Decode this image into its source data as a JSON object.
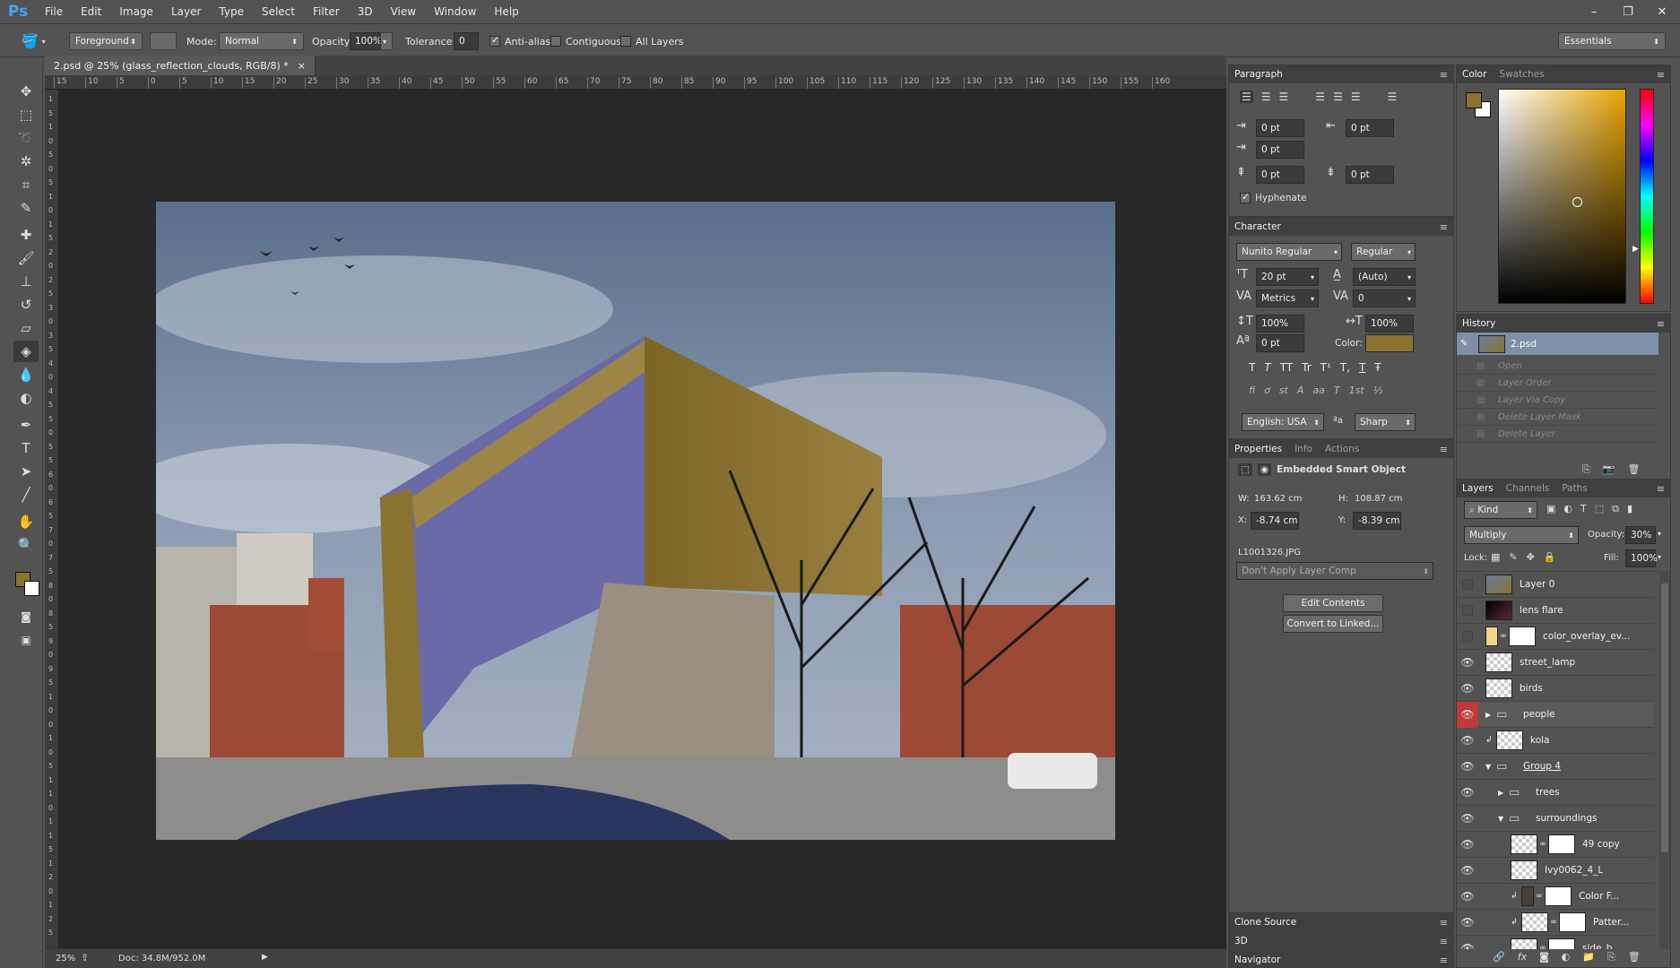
{
  "app": {
    "logo": "Ps",
    "menu": [
      "File",
      "Edit",
      "Image",
      "Layer",
      "Type",
      "Select",
      "Filter",
      "3D",
      "View",
      "Window",
      "Help"
    ],
    "window_controls": [
      "–",
      "❐",
      "✕"
    ]
  },
  "options_bar": {
    "fill_source": "Foreground",
    "mode_label": "Mode:",
    "mode_value": "Normal",
    "opacity_label": "Opacity:",
    "opacity_value": "100%",
    "tolerance_label": "Tolerance:",
    "tolerance_value": "0",
    "anti_alias_label": "Anti-alias",
    "anti_alias_checked": true,
    "contiguous_label": "Contiguous",
    "contiguous_checked": false,
    "all_layers_label": "All Layers",
    "all_layers_checked": false,
    "workspace": "Essentials"
  },
  "document": {
    "tab_title": "2.psd @ 25% (glass_reflection_clouds, RGB/8) *",
    "tab_close": "×",
    "ruler_top_ticks": [
      "15",
      "10",
      "5",
      "0",
      "5",
      "10",
      "15",
      "20",
      "25",
      "30",
      "35",
      "40",
      "45",
      "50",
      "55",
      "60",
      "65",
      "70",
      "75",
      "80",
      "85",
      "90",
      "95",
      "100",
      "105",
      "110",
      "115",
      "120",
      "125",
      "130",
      "135",
      "140",
      "145",
      "150",
      "155",
      "160"
    ],
    "ruler_left_ticks": [
      "1",
      "5",
      "1",
      "0",
      "5",
      "0",
      "5",
      "1",
      "0",
      "1",
      "5",
      "2",
      "0",
      "2",
      "5",
      "3",
      "0",
      "3",
      "5",
      "4",
      "0",
      "4",
      "5",
      "5",
      "0",
      "5",
      "5",
      "6",
      "0",
      "6",
      "5",
      "7",
      "0",
      "7",
      "5",
      "8",
      "0",
      "8",
      "5",
      "9",
      "0",
      "9",
      "5",
      "1",
      "0",
      "0",
      "1",
      "0",
      "5",
      "1",
      "1",
      "0",
      "1",
      "1",
      "5",
      "1",
      "2",
      "0",
      "1",
      "2",
      "5"
    ],
    "status_zoom": "25%",
    "status_doc": "Doc: 34.8M/952.0M"
  },
  "paragraph_panel": {
    "title": "Paragraph",
    "indent_left": "0 pt",
    "indent_right": "0 pt",
    "indent_first": "0 pt",
    "space_before": "0 pt",
    "space_after": "0 pt",
    "hyphenate_label": "Hyphenate",
    "hyphenate_checked": true
  },
  "character_panel": {
    "title": "Character",
    "font_family": "Nunito Regular",
    "font_style": "Regular",
    "font_size": "20 pt",
    "leading": "(Auto)",
    "kerning": "Metrics",
    "tracking": "0",
    "vertical_scale": "100%",
    "horizontal_scale": "100%",
    "baseline_shift": "0 pt",
    "color_label": "Color:",
    "color_value": "#8a7230",
    "style_buttons": [
      "T",
      "T",
      "TT",
      "Tr",
      "T¹",
      "T,",
      "T",
      "Ŧ"
    ],
    "opentype_buttons": [
      "fi",
      "ơ",
      "st",
      "A",
      "aa",
      "T",
      "1st",
      "½"
    ],
    "language": "English: USA",
    "aa_icon": "ªa",
    "antialias": "Sharp"
  },
  "properties_panel": {
    "tabs": [
      "Properties",
      "Info",
      "Actions"
    ],
    "kind": "Embedded Smart Object",
    "w_label": "W:",
    "w_value": "163.62 cm",
    "h_label": "H:",
    "h_value": "108.87 cm",
    "x_label": "X:",
    "x_value": "-8.74 cm",
    "y_label": "Y:",
    "y_value": "-8.39 cm",
    "source_file": "L1001326.JPG",
    "layer_comp": "Don't Apply Layer Comp",
    "edit_contents": "Edit Contents",
    "convert_linked": "Convert to Linked..."
  },
  "bottom_panels": [
    "Clone Source",
    "3D",
    "Navigator"
  ],
  "color_panel": {
    "tabs": [
      "Color",
      "Swatches"
    ],
    "foreground": "#8a7230",
    "background": "#ffffff",
    "hue_color": "#e8a400"
  },
  "history_panel": {
    "title": "History",
    "snapshot": "2.psd",
    "steps": [
      "Open",
      "Layer Order",
      "Layer Via Copy",
      "Delete Layer Mask",
      "Delete Layer"
    ]
  },
  "layers_panel": {
    "tabs": [
      "Layers",
      "Channels",
      "Paths"
    ],
    "filter_kind": "Kind",
    "blend_mode": "Multiply",
    "opacity_label": "Opacity:",
    "opacity": "30%",
    "lock_label": "Lock:",
    "fill_label": "Fill:",
    "fill": "100%",
    "layers": [
      {
        "name": "Layer 0",
        "visible": false,
        "type": "image"
      },
      {
        "name": "lens flare",
        "visible": false,
        "type": "dark"
      },
      {
        "name": "color_overlay_ev...",
        "visible": false,
        "type": "fill"
      },
      {
        "name": "street_lamp",
        "visible": true,
        "type": "pixel"
      },
      {
        "name": "birds",
        "visible": true,
        "type": "pixel"
      },
      {
        "name": "people",
        "visible": true,
        "type": "group"
      },
      {
        "name": "kola",
        "visible": true,
        "type": "pixel"
      },
      {
        "name": "Group 4",
        "visible": true,
        "type": "group-open"
      },
      {
        "name": "trees",
        "visible": true,
        "type": "group"
      },
      {
        "name": "surroundings",
        "visible": true,
        "type": "group-open"
      },
      {
        "name": "49 copy",
        "visible": true,
        "type": "masked"
      },
      {
        "name": "Ivy0062_4_L",
        "visible": true,
        "type": "smart"
      },
      {
        "name": "Color F...",
        "visible": true,
        "type": "colorfill"
      },
      {
        "name": "Patter...",
        "visible": true,
        "type": "pattern"
      },
      {
        "name": "side_b...",
        "visible": true,
        "type": "smart-masked"
      }
    ],
    "footer_icons": [
      "link-icon",
      "fx-icon",
      "mask-icon",
      "adjustment-icon",
      "folder-icon",
      "new-layer-icon",
      "trash-icon"
    ]
  },
  "tools": [
    "move",
    "marquee",
    "lasso",
    "quick-select",
    "crop",
    "eyedropper",
    "healing",
    "brush",
    "stamp",
    "history-brush",
    "eraser",
    "paint-bucket",
    "blur",
    "dodge",
    "pen",
    "type",
    "path-select",
    "line",
    "hand",
    "zoom"
  ]
}
